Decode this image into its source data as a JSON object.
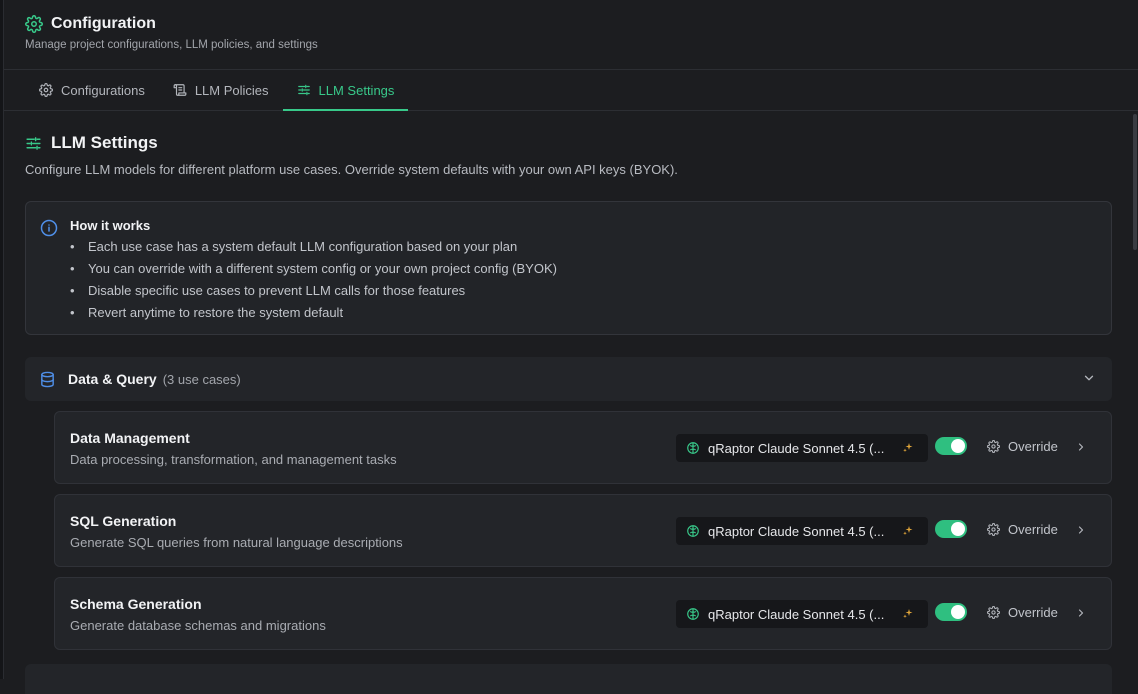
{
  "header": {
    "title": "Configuration",
    "subtitle": "Manage project configurations, LLM policies, and settings"
  },
  "tabs": [
    {
      "label": "Configurations",
      "icon": "gear-icon",
      "active": false
    },
    {
      "label": "LLM Policies",
      "icon": "scroll-icon",
      "active": false
    },
    {
      "label": "LLM Settings",
      "icon": "sliders-icon",
      "active": true
    }
  ],
  "section": {
    "title": "LLM Settings",
    "description": "Configure LLM models for different platform use cases. Override system defaults with your own API keys (BYOK)."
  },
  "info": {
    "title": "How it works",
    "items": [
      "Each use case has a system default LLM configuration based on your plan",
      "You can override with a different system config or your own project config (BYOK)",
      "Disable specific use cases to prevent LLM calls for those features",
      "Revert anytime to restore the system default"
    ]
  },
  "group": {
    "title": "Data & Query",
    "count": "(3 use cases)",
    "icon": "database-icon"
  },
  "use_cases": [
    {
      "name": "Data Management",
      "description": "Data processing, transformation, and management tasks",
      "model": "qRaptor Claude Sonnet 4.5 (...",
      "enabled": true,
      "override_label": "Override"
    },
    {
      "name": "SQL Generation",
      "description": "Generate SQL queries from natural language descriptions",
      "model": "qRaptor Claude Sonnet 4.5 (...",
      "enabled": true,
      "override_label": "Override"
    },
    {
      "name": "Schema Generation",
      "description": "Generate database schemas and migrations",
      "model": "qRaptor Claude Sonnet 4.5 (...",
      "enabled": true,
      "override_label": "Override"
    }
  ],
  "colors": {
    "accent": "#38c98a",
    "toggle_on": "#2fbf80",
    "info_blue": "#4f8fe8",
    "sparkle": "#e0a53a"
  }
}
